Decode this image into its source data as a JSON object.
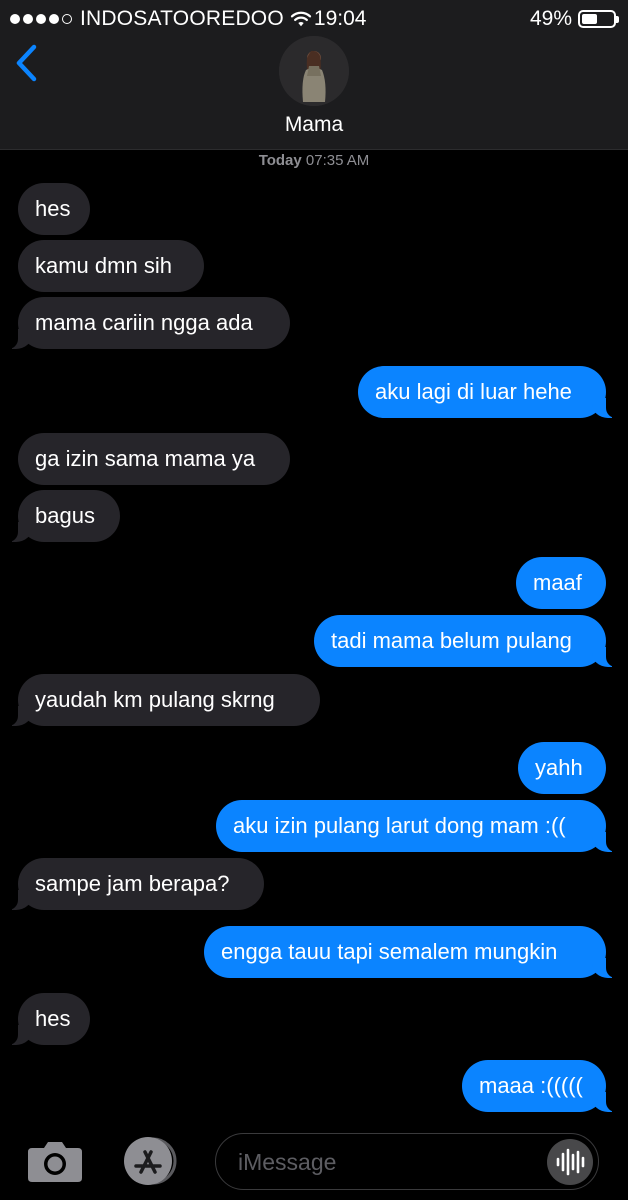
{
  "status_bar": {
    "carrier": "INDOSATOOREDOO",
    "time": "19:04",
    "battery_percent": "49%",
    "battery_level": 0.49,
    "signal_bars_filled": 4,
    "signal_bars_total": 5
  },
  "header": {
    "contact_name": "Mama",
    "back_icon": "chevron-left-icon",
    "accent_color": "#0b84ff"
  },
  "conversation": {
    "timestamp_day": "Today",
    "timestamp_time": "07:35 AM",
    "messages": [
      {
        "from": "them",
        "text": "hes"
      },
      {
        "from": "them",
        "text": "kamu dmn sih"
      },
      {
        "from": "them",
        "text": "mama cariin ngga ada"
      },
      {
        "from": "me",
        "text": "aku lagi di luar hehe"
      },
      {
        "from": "them",
        "text": "ga izin sama mama ya"
      },
      {
        "from": "them",
        "text": "bagus"
      },
      {
        "from": "me",
        "text": "maaf"
      },
      {
        "from": "me",
        "text": "tadi mama belum pulang"
      },
      {
        "from": "them",
        "text": "yaudah km pulang skrng"
      },
      {
        "from": "me",
        "text": "yahh"
      },
      {
        "from": "me",
        "text": "aku izin pulang larut dong mam :(("
      },
      {
        "from": "them",
        "text": "sampe jam berapa?"
      },
      {
        "from": "me",
        "text": "engga tauu tapi semalem mungkin"
      },
      {
        "from": "them",
        "text": "hes"
      },
      {
        "from": "me",
        "text": "maaa :((((("
      }
    ]
  },
  "input_bar": {
    "placeholder": "iMessage",
    "camera_icon": "camera-icon",
    "appstore_icon": "app-store-icon",
    "audio_icon": "audio-waveform-icon"
  },
  "colors": {
    "incoming_bubble": "#26252a",
    "outgoing_bubble": "#0b84ff",
    "header_bg": "#1c1c1e"
  }
}
